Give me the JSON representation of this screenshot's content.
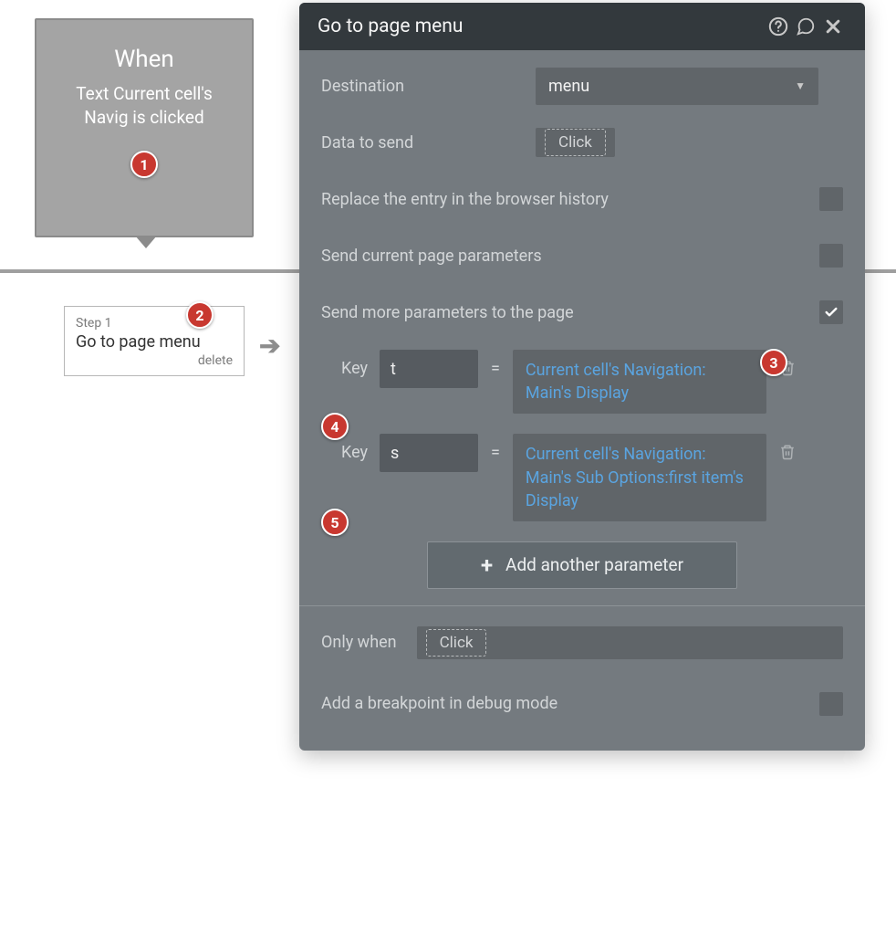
{
  "event": {
    "title": "When",
    "desc": "Text Current cell's Navig is clicked"
  },
  "step": {
    "label": "Step 1",
    "title": "Go to page menu",
    "delete": "delete"
  },
  "panel": {
    "title": "Go to page menu",
    "destination_label": "Destination",
    "destination_value": "menu",
    "data_to_send_label": "Data to send",
    "click_label": "Click",
    "replace_history_label": "Replace the entry in the browser history",
    "send_current_params_label": "Send current page parameters",
    "send_more_params_label": "Send more parameters to the page",
    "key_label1": "Key",
    "key_label2": "Key",
    "params": [
      {
        "key": "t",
        "value": "Current cell's Navigation: Main's Display"
      },
      {
        "key": "s",
        "value": "Current cell's Navigation: Main's Sub Options:first item's Display"
      }
    ],
    "add_param_label": "Add another parameter",
    "only_when_label": "Only when",
    "breakpoint_label": "Add a breakpoint in debug mode"
  },
  "badges": {
    "b1": "1",
    "b2": "2",
    "b3": "3",
    "b4": "4",
    "b5": "5"
  }
}
